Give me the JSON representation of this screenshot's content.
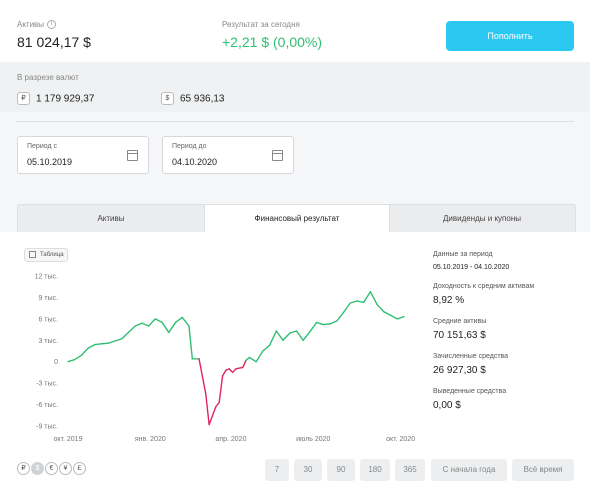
{
  "header": {
    "assets_label": "Активы",
    "assets_value": "81 024,17 $",
    "result_label": "Результат за сегодня",
    "result_value": "+2,21 $",
    "result_percent": "(0,00%)",
    "deposit_button": "Пополнить"
  },
  "currencies": {
    "label": "В разрезе валют",
    "items": [
      {
        "symbol": "₽",
        "value": "1 179 929,37"
      },
      {
        "symbol": "$",
        "value": "65 936,13"
      }
    ]
  },
  "period": {
    "from_label": "Период с",
    "from_value": "05.10.2019",
    "to_label": "Период до",
    "to_value": "04.10.2020"
  },
  "tabs": [
    {
      "label": "Активы",
      "active": false
    },
    {
      "label": "Финансовый результат",
      "active": true
    },
    {
      "label": "Дивиденды и купоны",
      "active": false
    }
  ],
  "table_button": "Таблица",
  "stats": {
    "period_label": "Данные за период",
    "period_value": "05.10.2019 - 04.10.2020",
    "yield_label": "Доходность к средним активам",
    "yield_value": "8,92 %",
    "avg_assets_label": "Средние активы",
    "avg_assets_value": "70 151,63 $",
    "credited_label": "Зачисленные средства",
    "credited_value": "26 927,30 $",
    "withdrawn_label": "Выведенные средства",
    "withdrawn_value": "0,00 $"
  },
  "currency_switch": [
    "₽",
    "$",
    "€",
    "¥",
    "£"
  ],
  "range_buttons": [
    "7",
    "30",
    "90",
    "180",
    "365",
    "С начала года",
    "Всё время"
  ],
  "colors": {
    "accent": "#2bc8f2",
    "positive": "#2fbf71",
    "negative": "#e0245e"
  },
  "chart_data": {
    "type": "line",
    "y_ticks": [
      "12 тыс.",
      "9 тыс.",
      "6 тыс.",
      "3 тыс.",
      "0",
      "-3 тыс.",
      "-6 тыс.",
      "-9 тыс."
    ],
    "x_ticks": [
      "окт. 2019",
      "янв. 2020",
      "апр. 2020",
      "июль 2020",
      "окт. 2020"
    ],
    "ylim": [
      -9000,
      12000
    ],
    "grid": false,
    "series": [
      {
        "points": [
          [
            0,
            0
          ],
          [
            2,
            300
          ],
          [
            4,
            900
          ],
          [
            6,
            1900
          ],
          [
            8,
            2400
          ],
          [
            10,
            2500
          ],
          [
            12,
            2600
          ],
          [
            14,
            2900
          ],
          [
            16,
            3200
          ],
          [
            18,
            4100
          ],
          [
            20,
            5000
          ],
          [
            22,
            5400
          ],
          [
            24,
            5000
          ],
          [
            26,
            6000
          ],
          [
            28,
            5500
          ],
          [
            30,
            4100
          ],
          [
            32,
            5500
          ],
          [
            34,
            6200
          ],
          [
            36,
            5000
          ],
          [
            37,
            400
          ],
          [
            39,
            400
          ],
          [
            41,
            -4500
          ],
          [
            42,
            -8800
          ],
          [
            44,
            -6300
          ],
          [
            45,
            -5700
          ],
          [
            46,
            -2000
          ],
          [
            47,
            -1200
          ],
          [
            48,
            -1000
          ],
          [
            49,
            -1500
          ],
          [
            50,
            -1000
          ],
          [
            52,
            -800
          ],
          [
            53,
            200
          ],
          [
            54,
            600
          ],
          [
            56,
            0
          ],
          [
            58,
            1500
          ],
          [
            60,
            2300
          ],
          [
            62,
            4300
          ],
          [
            64,
            3000
          ],
          [
            66,
            4000
          ],
          [
            68,
            4300
          ],
          [
            70,
            3000
          ],
          [
            72,
            4200
          ],
          [
            74,
            5500
          ],
          [
            76,
            5200
          ],
          [
            78,
            5300
          ],
          [
            80,
            5700
          ],
          [
            82,
            6900
          ],
          [
            84,
            8200
          ],
          [
            86,
            8500
          ],
          [
            88,
            8300
          ],
          [
            90,
            9800
          ],
          [
            92,
            8000
          ],
          [
            94,
            7000
          ],
          [
            96,
            6500
          ],
          [
            98,
            6000
          ],
          [
            100,
            6300
          ]
        ]
      }
    ]
  }
}
